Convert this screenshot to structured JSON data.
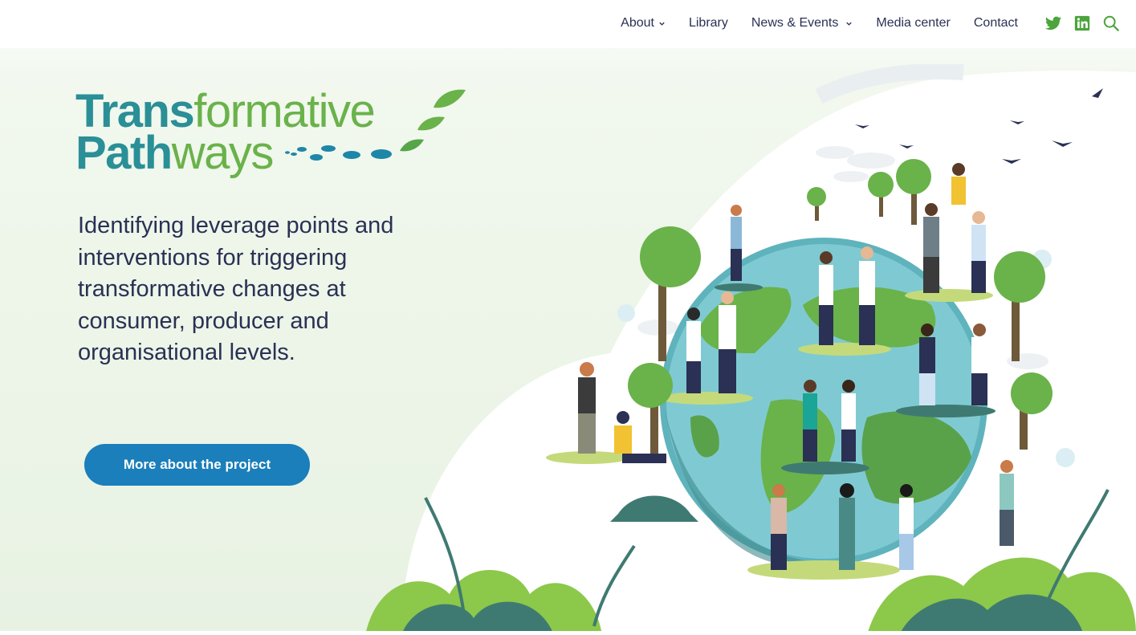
{
  "nav": {
    "items": [
      {
        "label": "About",
        "dropdown": true
      },
      {
        "label": "Library",
        "dropdown": false
      },
      {
        "label": "News & Events",
        "dropdown": true
      },
      {
        "label": "Media center",
        "dropdown": false
      },
      {
        "label": "Contact",
        "dropdown": false
      }
    ],
    "social": [
      "twitter-icon",
      "linkedin-icon",
      "search-icon"
    ]
  },
  "logo": {
    "line1_bold": "Trans",
    "line1_light": "formative",
    "line2_bold": "Path",
    "line2_light": "ways"
  },
  "hero": {
    "tagline": "Identifying leverage points and interventions for triggering transformative changes at consumer, producer and organisational levels.",
    "cta_label": "More about the project"
  },
  "colors": {
    "accent_green": "#6ab24a",
    "brand_teal": "#2a8f96",
    "button_blue": "#1a7fba",
    "text_navy": "#2a3154"
  }
}
